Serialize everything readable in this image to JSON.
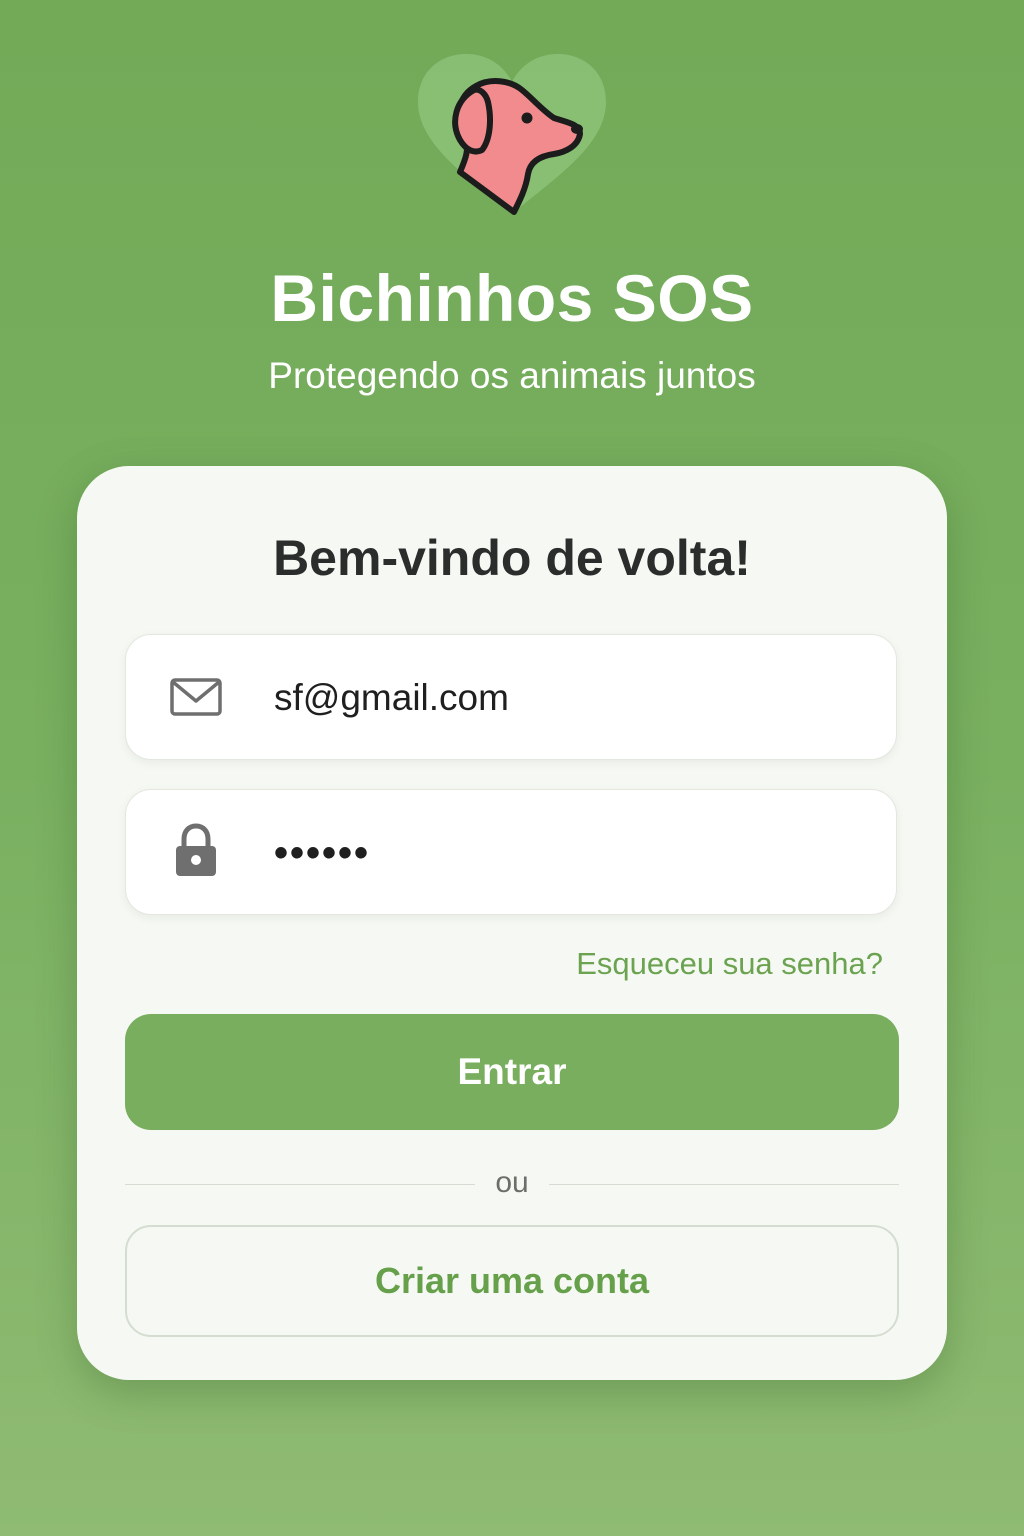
{
  "brand": {
    "title": "Bichinhos SOS",
    "subtitle": "Protegendo os animais juntos",
    "logo_icon": "heart-dog-logo-icon",
    "colors": {
      "background": "#78ae5d",
      "heart": "#8cc278",
      "dog": "#f28b8e",
      "accent": "#6ba350"
    }
  },
  "login": {
    "heading": "Bem-vindo de volta!",
    "email": {
      "icon": "mail-icon",
      "value": "sf@gmail.com"
    },
    "password": {
      "icon": "lock-icon",
      "value": "••••••"
    },
    "forgot_link": "Esqueceu sua senha?",
    "submit_label": "Entrar",
    "divider_text": "ou",
    "create_account_label": "Criar uma conta"
  }
}
